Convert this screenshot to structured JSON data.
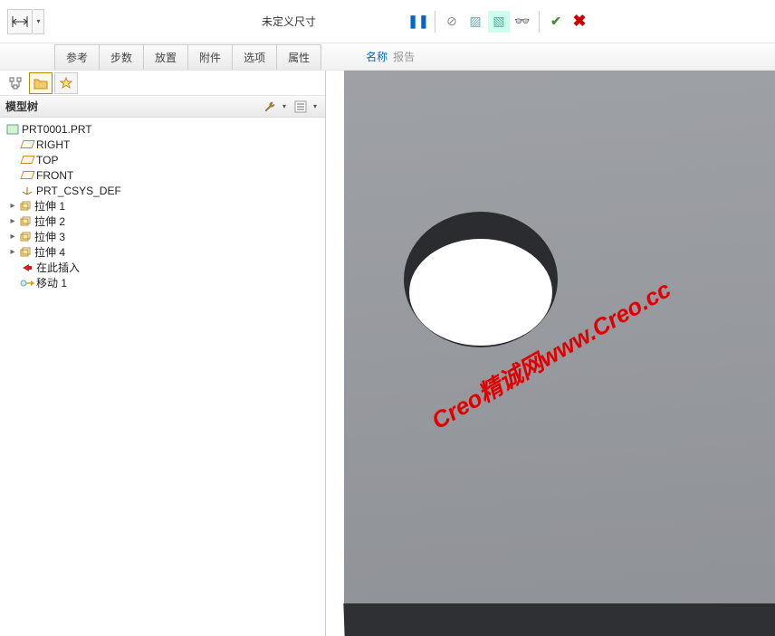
{
  "top": {
    "dimension_status": "未定义尺寸",
    "icons": {
      "pause": "❚❚",
      "forbid": "⊘",
      "slash1": "▨",
      "slash2": "▧",
      "glasses": "👓",
      "check": "✔",
      "close": "✖"
    }
  },
  "tabs": [
    "参考",
    "步数",
    "放置",
    "附件",
    "选项",
    "属性"
  ],
  "links": {
    "name": "名称",
    "report": "报告"
  },
  "tree": {
    "title": "模型树",
    "root": "PRT0001.PRT",
    "planes": [
      "RIGHT",
      "TOP",
      "FRONT"
    ],
    "csys": "PRT_CSYS_DEF",
    "extrudes": [
      "拉伸 1",
      "拉伸 2",
      "拉伸 3",
      "拉伸 4"
    ],
    "insert_here": "在此插入",
    "move": "移动 1"
  },
  "watermark": "Creo精诚网www.Creo.cc"
}
